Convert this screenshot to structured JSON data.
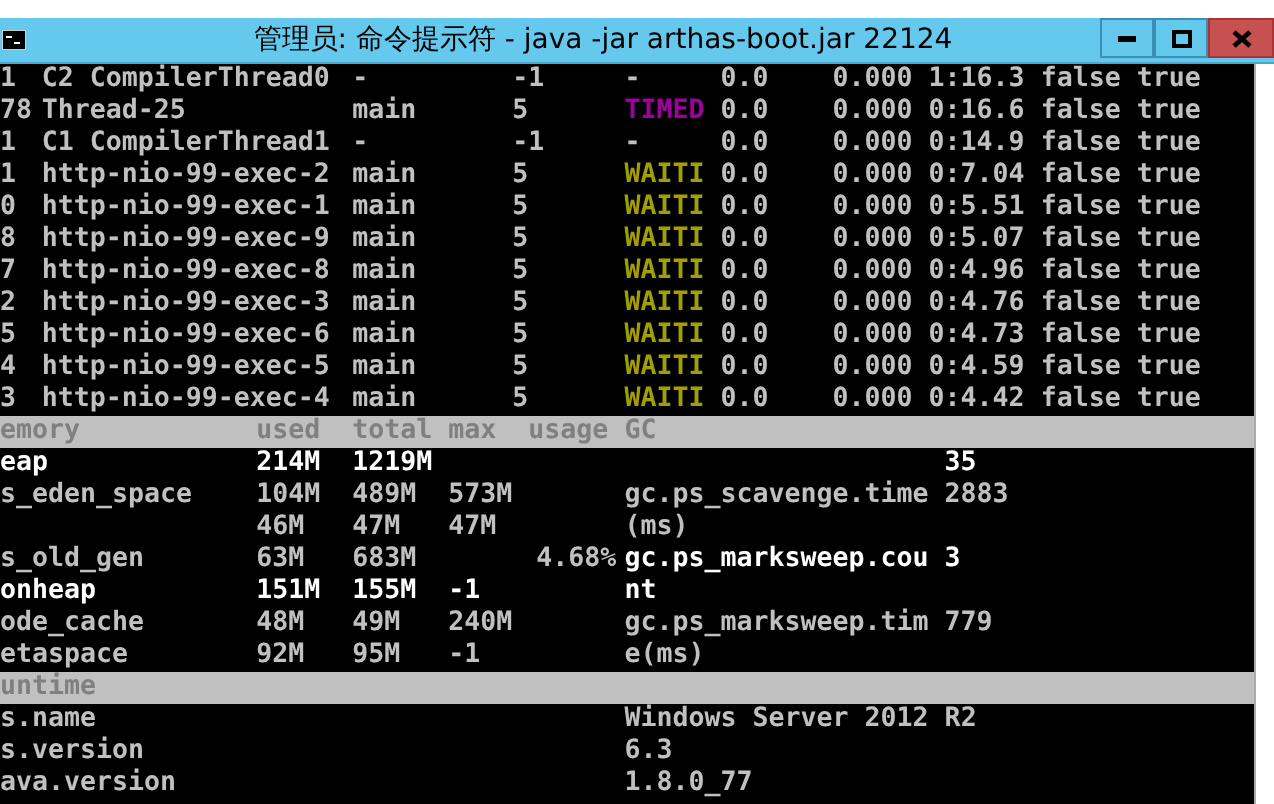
{
  "window": {
    "title": "管理员: 命令提示符 - java  -jar arthas-boot.jar 22124"
  },
  "threads": [
    {
      "id": "1",
      "name": "C2 CompilerThread0",
      "group": "-",
      "priority": "-1",
      "state": "-",
      "color": "#c0c0c0",
      "cpu": "0.0",
      "time_pct": "0.000",
      "time": "1:16.3",
      "interrupted": "false",
      "daemon": "true"
    },
    {
      "id": "78",
      "name": "Thread-25",
      "group": "main",
      "priority": "5",
      "state": "TIMED",
      "color": "#a000a0",
      "cpu": "0.0",
      "time_pct": "0.000",
      "time": "0:16.6",
      "interrupted": "false",
      "daemon": "true"
    },
    {
      "id": "1",
      "name": "C1 CompilerThread1",
      "group": "-",
      "priority": "-1",
      "state": "-",
      "color": "#c0c0c0",
      "cpu": "0.0",
      "time_pct": "0.000",
      "time": "0:14.9",
      "interrupted": "false",
      "daemon": "true"
    },
    {
      "id": "1",
      "name": "http-nio-99-exec-2",
      "group": "main",
      "priority": "5",
      "state": "WAITI",
      "color": "#a0a000",
      "cpu": "0.0",
      "time_pct": "0.000",
      "time": "0:7.04",
      "interrupted": "false",
      "daemon": "true"
    },
    {
      "id": "0",
      "name": "http-nio-99-exec-1",
      "group": "main",
      "priority": "5",
      "state": "WAITI",
      "color": "#a0a000",
      "cpu": "0.0",
      "time_pct": "0.000",
      "time": "0:5.51",
      "interrupted": "false",
      "daemon": "true"
    },
    {
      "id": "8",
      "name": "http-nio-99-exec-9",
      "group": "main",
      "priority": "5",
      "state": "WAITI",
      "color": "#a0a000",
      "cpu": "0.0",
      "time_pct": "0.000",
      "time": "0:5.07",
      "interrupted": "false",
      "daemon": "true"
    },
    {
      "id": "7",
      "name": "http-nio-99-exec-8",
      "group": "main",
      "priority": "5",
      "state": "WAITI",
      "color": "#a0a000",
      "cpu": "0.0",
      "time_pct": "0.000",
      "time": "0:4.96",
      "interrupted": "false",
      "daemon": "true"
    },
    {
      "id": "2",
      "name": "http-nio-99-exec-3",
      "group": "main",
      "priority": "5",
      "state": "WAITI",
      "color": "#a0a000",
      "cpu": "0.0",
      "time_pct": "0.000",
      "time": "0:4.76",
      "interrupted": "false",
      "daemon": "true"
    },
    {
      "id": "5",
      "name": "http-nio-99-exec-6",
      "group": "main",
      "priority": "5",
      "state": "WAITI",
      "color": "#a0a000",
      "cpu": "0.0",
      "time_pct": "0.000",
      "time": "0:4.73",
      "interrupted": "false",
      "daemon": "true"
    },
    {
      "id": "4",
      "name": "http-nio-99-exec-5",
      "group": "main",
      "priority": "5",
      "state": "WAITI",
      "color": "#a0a000",
      "cpu": "0.0",
      "time_pct": "0.000",
      "time": "0:4.59",
      "interrupted": "false",
      "daemon": "true"
    },
    {
      "id": "3",
      "name": "http-nio-99-exec-4",
      "group": "main",
      "priority": "5",
      "state": "WAITI",
      "color": "#a0a000",
      "cpu": "0.0",
      "time_pct": "0.000",
      "time": "0:4.42",
      "interrupted": "false",
      "daemon": "true"
    }
  ],
  "memory": {
    "columns": [
      "emory",
      "used",
      "total",
      "max",
      "usage",
      "GC"
    ],
    "rows": [
      {
        "name": "eap",
        "used": "214M",
        "total": "1219M",
        "bright": true,
        "gc_value": "35",
        "gc_bright": true
      },
      {
        "name": "s_eden_space",
        "used": "104M",
        "total": "489M",
        "max": "573M",
        "bright": false,
        "gc_name": "gc.ps_scavenge.time",
        "gc_value": "2883",
        "gc_bright": false
      },
      {
        "used": "46M",
        "total": "47M",
        "max": "47M",
        "bright": false,
        "gc_name": "(ms)",
        "gc_bright": false
      },
      {
        "name": "s_old_gen",
        "used": "63M",
        "total": "683M",
        "usage": "4.68%",
        "bright": false,
        "gc_name": "gc.ps_marksweep.cou",
        "gc_value": "3",
        "gc_bright": true
      },
      {
        "name": "onheap",
        "used": "151M",
        "total": "155M",
        "max": "-1",
        "bright": true,
        "gc_name": "nt",
        "gc_bright": true
      },
      {
        "name": "ode_cache",
        "used": "48M",
        "total": "49M",
        "max": "240M",
        "bright": false,
        "gc_name": "gc.ps_marksweep.tim",
        "gc_value": "779",
        "gc_bright": false
      },
      {
        "name": "etaspace",
        "used": "92M",
        "total": "95M",
        "max": "-1",
        "bright": false,
        "gc_name": "e(ms)",
        "gc_bright": false
      }
    ]
  },
  "runtime": {
    "header": "untime",
    "rows": [
      {
        "name": "s.name",
        "value": "Windows Server 2012 R2"
      },
      {
        "name": "s.version",
        "value": "6.3"
      },
      {
        "name": "ava.version",
        "value": "1.8.0_77"
      }
    ]
  }
}
